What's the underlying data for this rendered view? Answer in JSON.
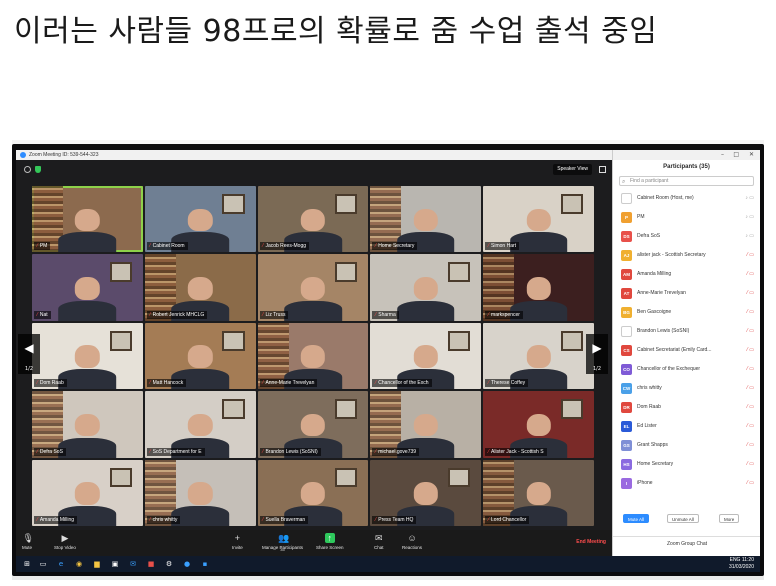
{
  "caption": "이러는 사람들 98프로의 확률로 줌 수업 출석 중임",
  "zoom": {
    "window_title": "Zoom Meeting ID: 539-544-323",
    "speaker_view_label": "Speaker View",
    "page_indicator": "1/2",
    "tiles": [
      {
        "name": "PM",
        "bg": "#8c6a4e",
        "active": true
      },
      {
        "name": "Cabinet Room",
        "bg": "#6f7f93"
      },
      {
        "name": "Jacob Rees-Mogg",
        "bg": "#7b6a55"
      },
      {
        "name": "Home Secretary",
        "bg": "#b9b6b0"
      },
      {
        "name": "Simon Hart",
        "bg": "#d9d2c7"
      },
      {
        "name": "Nat",
        "bg": "#5b4b6b"
      },
      {
        "name": "Robert Jenrick MHCLG",
        "bg": "#8b6b49"
      },
      {
        "name": "Liz Truss",
        "bg": "#a58566"
      },
      {
        "name": "Sharma",
        "bg": "#c7c2ba"
      },
      {
        "name": "markspencer",
        "bg": "#3c1f1f"
      },
      {
        "name": "Dom Raab",
        "bg": "#e6e1d8"
      },
      {
        "name": "Matt Hancock",
        "bg": "#a47c55"
      },
      {
        "name": "Anne-Marie Trevelyan",
        "bg": "#9a7a6a"
      },
      {
        "name": "Chancellor of the Exch",
        "bg": "#e2ddd5"
      },
      {
        "name": "Therese Coffey",
        "bg": "#d8d3cb"
      },
      {
        "name": "Defra SoS",
        "bg": "#cfc7bd"
      },
      {
        "name": "SoS Department for E",
        "bg": "#d4cec6"
      },
      {
        "name": "Brandon Lewis (SoSNI)",
        "bg": "#7e6d5c"
      },
      {
        "name": "michael.gove739",
        "bg": "#b8b0a5"
      },
      {
        "name": "Alister Jack - Scottish S",
        "bg": "#7a2a28"
      },
      {
        "name": "Amanda Milling",
        "bg": "#d8d0c8"
      },
      {
        "name": "chris whitty",
        "bg": "#c5bfb8"
      },
      {
        "name": "Suella Braverman",
        "bg": "#8a6f55"
      },
      {
        "name": "Press Team HQ",
        "bg": "#5a4a3e"
      },
      {
        "name": "Lord Chancellor",
        "bg": "#6a5a4c"
      }
    ],
    "toolbar": {
      "mute": "Mute",
      "stop_video": "Stop Video",
      "invite": "Invite",
      "manage_participants": "Manage Participants",
      "participant_count": "35",
      "share_screen": "Share Screen",
      "chat": "Chat",
      "reactions": "Reactions",
      "end_meeting": "End Meeting"
    },
    "participants_panel": {
      "title": "Participants (35)",
      "search_placeholder": "Find a participant",
      "participants": [
        {
          "initials": "",
          "name": "Cabinet Room (Host, me)",
          "color": "#ffffff",
          "muted": false
        },
        {
          "initials": "P",
          "name": "PM",
          "color": "#f0a030",
          "muted": false
        },
        {
          "initials": "DS",
          "name": "Defra SoS",
          "color": "#e8504a",
          "muted": false
        },
        {
          "initials": "AJ",
          "name": "alister jack - Scottish Secretary",
          "color": "#f0b030",
          "muted": true
        },
        {
          "initials": "AM",
          "name": "Amanda Milling",
          "color": "#e0483e",
          "muted": true
        },
        {
          "initials": "AT",
          "name": "Anne-Marie Trevelyan",
          "color": "#e0483e",
          "muted": true
        },
        {
          "initials": "BG",
          "name": "Ben Gascoigne",
          "color": "#f0b030",
          "muted": true
        },
        {
          "initials": "",
          "name": "Brandon Lewis (SoSNI)",
          "color": "#ffffff",
          "muted": true
        },
        {
          "initials": "CS",
          "name": "Cabinet Secretariat (Emily Card...",
          "color": "#e0483e",
          "muted": true
        },
        {
          "initials": "CO",
          "name": "Chancellor of the Exchequer",
          "color": "#7f5bd6",
          "muted": true
        },
        {
          "initials": "CW",
          "name": "chris whitty",
          "color": "#4aa0e8",
          "muted": true
        },
        {
          "initials": "DR",
          "name": "Dom Raab",
          "color": "#e0483e",
          "muted": true
        },
        {
          "initials": "EL",
          "name": "Ed Lister",
          "color": "#2a5ad8",
          "muted": true
        },
        {
          "initials": "GS",
          "name": "Grant Shapps",
          "color": "#7f8fd6",
          "muted": true
        },
        {
          "initials": "HS",
          "name": "Home Secretary",
          "color": "#8a6ae0",
          "muted": true
        },
        {
          "initials": "I",
          "name": "iPhone",
          "color": "#9a6ae0",
          "muted": true
        }
      ],
      "mute_all": "Mute All",
      "unmute_all": "Unmute All",
      "more": "More",
      "group_chat": "Zoom Group Chat"
    },
    "taskbar": {
      "time": "11:20",
      "date": "31/03/2020",
      "language": "ENG"
    }
  }
}
